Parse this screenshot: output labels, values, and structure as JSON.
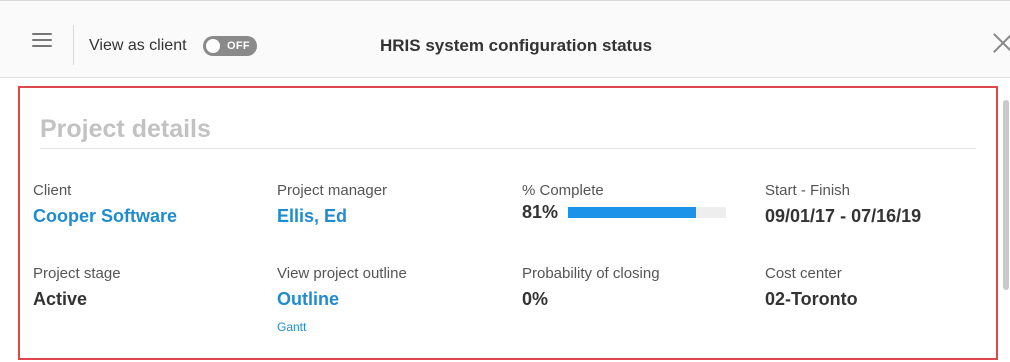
{
  "header": {
    "view_as_client_label": "View as client",
    "toggle_state": "OFF",
    "title": "HRIS system configuration status",
    "menu_icon": "hamburger-menu-icon",
    "close_icon": "close-icon"
  },
  "panel": {
    "section_title": "Project details",
    "highlight_color": "#e0474c",
    "fields": {
      "client": {
        "label": "Client",
        "value": "Cooper Software"
      },
      "project_manager": {
        "label": "Project manager",
        "value": "Ellis, Ed"
      },
      "percent_complete": {
        "label": "% Complete",
        "value": "81%",
        "fraction": 0.81
      },
      "start_finish": {
        "label": "Start - Finish",
        "value": "09/01/17 - 07/16/19"
      },
      "project_stage": {
        "label": "Project stage",
        "value": "Active"
      },
      "project_outline": {
        "label": "View project outline",
        "value": "Outline",
        "secondary_link": "Gantt"
      },
      "probability": {
        "label": "Probability of closing",
        "value": "0%"
      },
      "cost_center": {
        "label": "Cost center",
        "value": "02-Toronto"
      }
    }
  },
  "colors": {
    "link": "#1f8cd0",
    "progress_fill": "#1a93e8"
  }
}
